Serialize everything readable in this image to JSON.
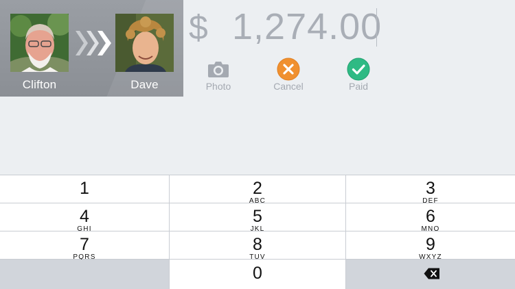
{
  "transfer": {
    "from_name": "Clifton",
    "to_name": "Dave"
  },
  "amount": {
    "currency_symbol": "$",
    "value": "1,274.00"
  },
  "actions": {
    "photo_label": "Photo",
    "cancel_label": "Cancel",
    "paid_label": "Paid"
  },
  "keypad": {
    "keys": [
      {
        "digit": "1",
        "letters": ""
      },
      {
        "digit": "2",
        "letters": "ABC"
      },
      {
        "digit": "3",
        "letters": "DEF"
      },
      {
        "digit": "4",
        "letters": "GHI"
      },
      {
        "digit": "5",
        "letters": "JKL"
      },
      {
        "digit": "6",
        "letters": "MNO"
      },
      {
        "digit": "7",
        "letters": "PQRS"
      },
      {
        "digit": "8",
        "letters": "TUV"
      },
      {
        "digit": "9",
        "letters": "WXYZ"
      },
      {
        "digit": "0",
        "letters": ""
      }
    ],
    "delete_icon": "backspace-icon"
  },
  "colors": {
    "cancel": "#f0902f",
    "paid": "#2fba84",
    "photo_icon": "#a4a9b1",
    "panel": "#8f9399"
  }
}
